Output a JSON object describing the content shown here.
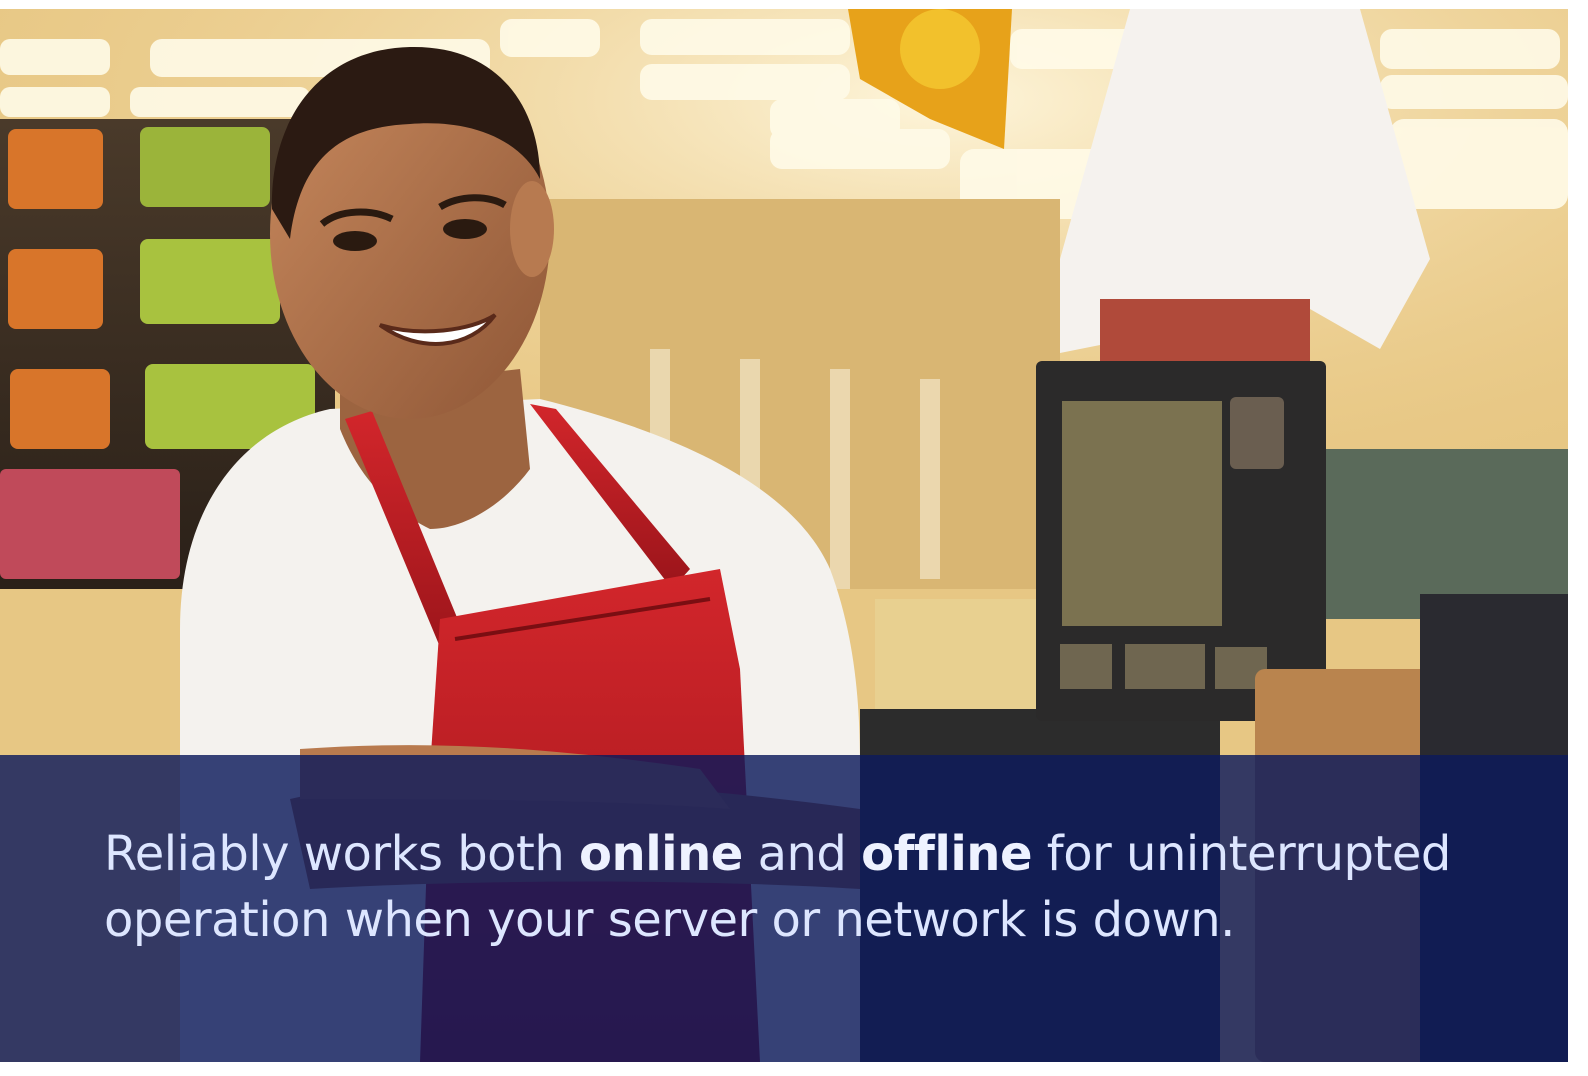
{
  "caption": {
    "part1": "Reliably works both ",
    "bold1": "online",
    "part2": " and ",
    "bold2": "offline",
    "part3": " for uninterrupted operation when your server or network is down."
  },
  "colors": {
    "caption_band": "#0c1a5c",
    "caption_text": "#dde6ff",
    "apron": "#c42026",
    "shirt": "#f4f2ee"
  }
}
